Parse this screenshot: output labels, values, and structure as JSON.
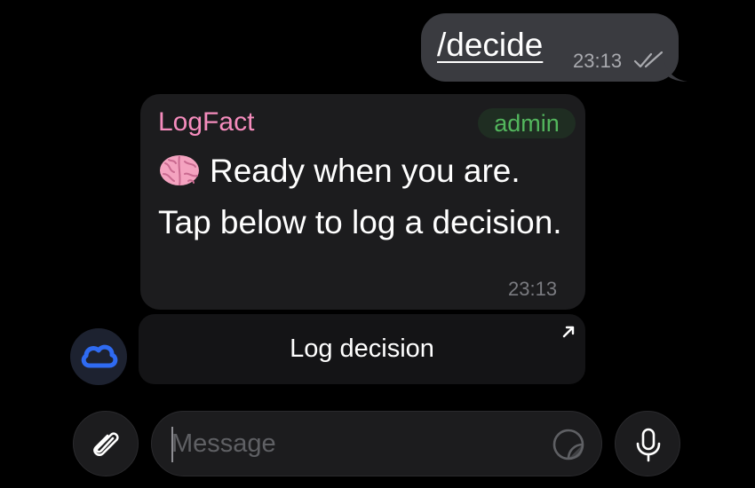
{
  "outgoing_message": {
    "text": "/decide",
    "time": "23:13",
    "status_icon": "double-check-icon"
  },
  "incoming_message": {
    "sender": "LogFact",
    "badge": "admin",
    "emoji_icon": "brain-emoji",
    "text": "Ready when you are. Tap below to log a decision.",
    "time": "23:13"
  },
  "inline_button": {
    "label": "Log decision",
    "icon": "open-link-arrow-icon"
  },
  "bot_avatar": {
    "icon": "cloud-icon"
  },
  "composer": {
    "placeholder": "Message",
    "attach_icon": "paperclip-icon",
    "sticker_icon": "sticker-icon",
    "mic_icon": "microphone-icon"
  },
  "colors": {
    "background": "#000000",
    "outgoing_bubble": "#3a3b40",
    "incoming_bubble": "#1c1c1e",
    "sender_name": "#f58cbd",
    "admin_badge": "#53b65d",
    "avatar_cloud": "#2f6bf2"
  }
}
